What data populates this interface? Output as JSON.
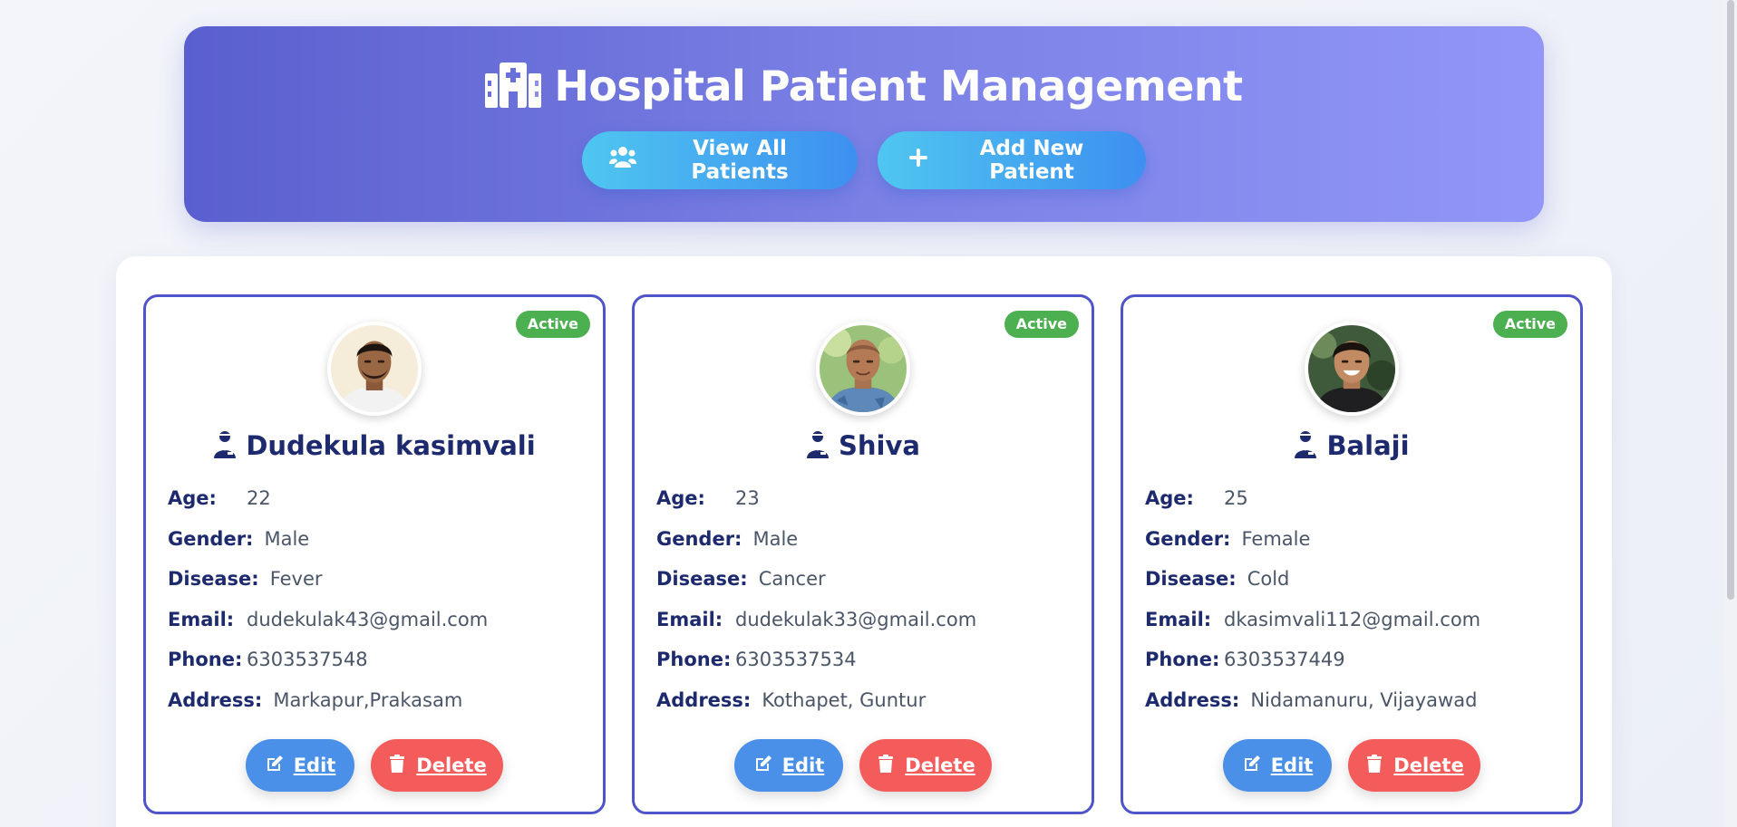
{
  "header": {
    "title": "Hospital Patient Management",
    "title_icon": "hospital-icon",
    "view_all_label": "View All Patients",
    "view_all_icon": "users-icon",
    "add_new_label": "Add New Patient",
    "add_new_icon": "plus-icon"
  },
  "labels": {
    "age": "Age:",
    "gender": "Gender:",
    "disease": "Disease:",
    "email": "Email:",
    "phone": "Phone:",
    "address": "Address:",
    "edit": "Edit",
    "delete": "Delete"
  },
  "colors": {
    "header_gradient_start": "#5a5fcf",
    "header_gradient_end": "#9196f8",
    "card_border": "#4f55c8",
    "badge_active": "#4caf50",
    "edit_button": "#4a90e8",
    "delete_button": "#f45b5b",
    "text_dark": "#1e2a6e"
  },
  "patients": [
    {
      "status": "Active",
      "name": "Dudekula kasimvali",
      "age": "22",
      "gender": "Male",
      "disease": "Fever",
      "email": "dudekulak43@gmail.com",
      "phone": "6303537548",
      "address": "Markapur,Prakasam"
    },
    {
      "status": "Active",
      "name": "Shiva",
      "age": "23",
      "gender": "Male",
      "disease": "Cancer",
      "email": "dudekulak33@gmail.com",
      "phone": "6303537534",
      "address": "Kothapet, Guntur"
    },
    {
      "status": "Active",
      "name": "Balaji",
      "age": "25",
      "gender": "Female",
      "disease": "Cold",
      "email": "dkasimvali112@gmail.com",
      "phone": "6303537449",
      "address": "Nidamanuru, Vijayawad"
    }
  ]
}
